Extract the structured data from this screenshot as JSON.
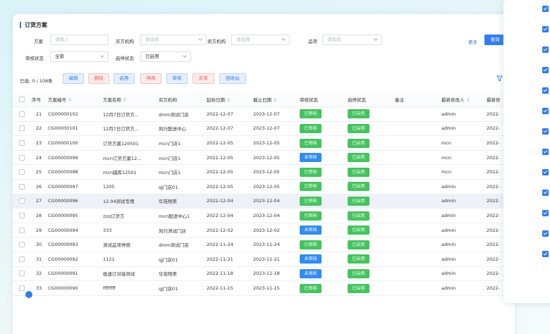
{
  "page": {
    "title": "订货方案"
  },
  "filters": {
    "scheme_label": "方案",
    "scheme_placeholder": "请输入",
    "buyer_label": "买方机构",
    "buyer_placeholder": "请选择",
    "seller_label": "卖方机构",
    "seller_placeholder": "请选择",
    "item_label": "品项",
    "item_placeholder": "请选择",
    "audit_label": "审核状态",
    "audit_value": "全部",
    "status_label": "启停状态",
    "status_value": "已启用",
    "more": "更多",
    "query": "查询"
  },
  "toolbar": {
    "selection": "已选: 0 / 108条",
    "edit": "编辑",
    "delete": "删除",
    "enable": "启用",
    "disable": "停用",
    "audit": "审核",
    "unaudit": "反审",
    "recycle": "回收站"
  },
  "table": {
    "headers": [
      "序号",
      "方案编号",
      "方案名称",
      "买方机构",
      "起始日期",
      "截止日期",
      "审核状态",
      "启停状态",
      "备注",
      "最新修改人",
      "最新修"
    ],
    "rows": [
      {
        "no": "21",
        "code": "CG00000102",
        "name": "12月7日订货方...",
        "buyer": "dmm测试门店",
        "start": "2022-12-07",
        "end": "2023-12-07",
        "audit": "已审核",
        "status": "已启用",
        "note": "",
        "modifier": "admin",
        "modified": "2022-"
      },
      {
        "no": "22",
        "code": "CG00000101",
        "name": "12月7日订货方...",
        "buyer": "风行配送中心",
        "start": "2022-12-07",
        "end": "2023-12-07",
        "audit": "已审核",
        "status": "已启用",
        "note": "",
        "modifier": "admin",
        "modified": "2022-"
      },
      {
        "no": "23",
        "code": "CG00000100",
        "name": "订货方案120501",
        "buyer": "mcn门店1",
        "start": "2022-12-05",
        "end": "2023-12-05",
        "audit": "已审核",
        "status": "已启用",
        "note": "",
        "modifier": "mcn",
        "modified": "2022-"
      },
      {
        "no": "24",
        "code": "CG00000099",
        "name": "mcn订货方案12...",
        "buyer": "mcn门店1",
        "start": "2022-12-05",
        "end": "2023-12-05",
        "audit": "未审核",
        "status": "已启用",
        "note": "",
        "modifier": "mcn",
        "modified": "2022-"
      },
      {
        "no": "25",
        "code": "CG00000098",
        "name": "mcn越库12501",
        "buyer": "mcn门店1",
        "start": "2022-12-05",
        "end": "2023-12-05",
        "audit": "已审核",
        "status": "已启用",
        "note": "",
        "modifier": "mcn",
        "modified": "2022-"
      },
      {
        "no": "26",
        "code": "CG00000097",
        "name": "1205",
        "buyer": "qj门店01",
        "start": "2022-12-05",
        "end": "2023-12-05",
        "audit": "已审核",
        "status": "已启用",
        "note": "",
        "modifier": "admin",
        "modified": "2022-"
      },
      {
        "no": "27",
        "code": "CG00000096",
        "name": "12.04测试专用",
        "buyer": "华苑物美",
        "start": "2022-12-04",
        "end": "2023-12-04",
        "audit": "已审核",
        "status": "已启用",
        "note": "",
        "modifier": "admin",
        "modified": "2022-"
      },
      {
        "no": "28",
        "code": "CG00000095",
        "name": "zzq订货方",
        "buyer": "mcn配送中心1",
        "start": "2022-12-04",
        "end": "2023-12-04",
        "audit": "已审核",
        "status": "已启用",
        "note": "",
        "modifier": "admin",
        "modified": "2022-"
      },
      {
        "no": "29",
        "code": "CG00000094",
        "name": "333",
        "buyer": "风行测试门店",
        "start": "2022-12-02",
        "end": "2023-12-02",
        "audit": "未审核",
        "status": "已启用",
        "note": "",
        "modifier": "admin",
        "modified": "2022-"
      },
      {
        "no": "30",
        "code": "CG00000093",
        "name": "测试品项停用",
        "buyer": "dmm测试门店",
        "start": "2022-11-24",
        "end": "2023-11-24",
        "audit": "已审核",
        "status": "已启用",
        "note": "",
        "modifier": "admin",
        "modified": "2022-"
      },
      {
        "no": "31",
        "code": "CG00000092",
        "name": "1121",
        "buyer": "qj门店01",
        "start": "2022-11-21",
        "end": "2023-11-21",
        "audit": "未审核",
        "status": "已启用",
        "note": "",
        "modifier": "admin",
        "modified": "2022-"
      },
      {
        "no": "32",
        "code": "CG00000091",
        "name": "极速订对接测试",
        "buyer": "华苑物美",
        "start": "2022-11-18",
        "end": "2023-11-18",
        "audit": "未审核",
        "status": "已启用",
        "note": "",
        "modifier": "admin",
        "modified": "2022-"
      },
      {
        "no": "33",
        "code": "CG00000090",
        "name": "ffffffff",
        "buyer": "qj门店01",
        "start": "2022-11-15",
        "end": "2023-11-15",
        "audit": "已审核",
        "status": "已启用",
        "note": "",
        "modifier": "admin",
        "modified": "2022-"
      }
    ]
  },
  "colors": {
    "accent": "#2f7cf6",
    "approved": "#43c55c",
    "unapproved": "#2f8cf6",
    "danger": "#f05b5b"
  },
  "icons": {
    "filter": "filter-icon",
    "sort": "sort-icon",
    "checkbox": "checkbox-icon"
  }
}
